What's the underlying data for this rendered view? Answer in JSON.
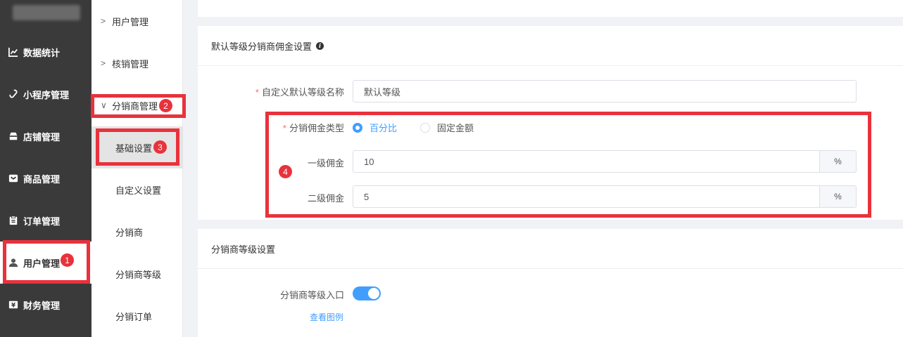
{
  "left_nav": {
    "items": [
      {
        "label": "数据统计",
        "icon": "chart-line-icon"
      },
      {
        "label": "小程序管理",
        "icon": "link-icon"
      },
      {
        "label": "店铺管理",
        "icon": "store-icon"
      },
      {
        "label": "商品管理",
        "icon": "box-icon"
      },
      {
        "label": "订单管理",
        "icon": "clipboard-icon"
      },
      {
        "label": "用户管理",
        "icon": "user-icon"
      },
      {
        "label": "财务管理",
        "icon": "yen-icon"
      }
    ]
  },
  "sub_nav": {
    "groups": [
      "用户管理",
      "核销管理",
      "分销商管理"
    ],
    "children": [
      "基础设置",
      "自定义设置",
      "分销商",
      "分销商等级",
      "分销订单"
    ]
  },
  "panel_a": {
    "title": "默认等级分销商佣金设置",
    "level_name_label": "自定义默认等级名称",
    "level_name_value": "默认等级",
    "commission_type_label": "分销佣金类型",
    "radio_percent": "百分比",
    "radio_fixed": "固定金额",
    "first_label": "一级佣金",
    "first_value": "10",
    "second_label": "二级佣金",
    "second_value": "5",
    "unit": "%"
  },
  "panel_b": {
    "title": "分销商等级设置",
    "entry_label": "分销商等级入口",
    "view_example": "查看图例"
  },
  "annotations": {
    "b1": "1",
    "b2": "2",
    "b3": "3",
    "b4": "4"
  },
  "colors": {
    "highlight": "#e8323c",
    "accent": "#409eff",
    "sidebar": "#3a3a3a"
  }
}
